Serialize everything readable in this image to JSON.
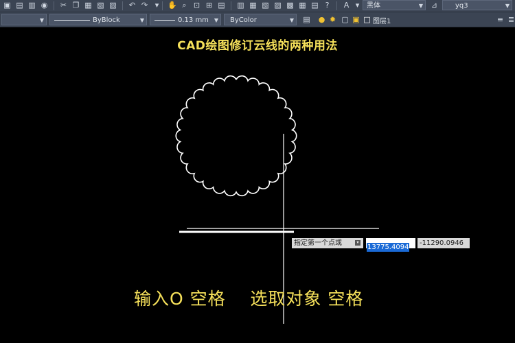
{
  "toolbar": {
    "font_name": "黑体",
    "style_name": "yq3",
    "linetype_label": "ByBlock",
    "lineweight_label": "0.13 mm",
    "color_label": "ByColor",
    "layer_label": "图层1",
    "icons": [
      "print-icon",
      "save-icon",
      "open-icon",
      "match-icon",
      "undo-icon",
      "redo-icon",
      "pan-icon",
      "zoom-icon",
      "help-icon",
      "text-icon",
      "bulb-icon",
      "sun-icon",
      "lock-icon"
    ]
  },
  "canvas": {
    "title": "CAD绘图修订云线的两种用法",
    "prompt_label": "指定第一个点或",
    "coord_x": "13775.4094",
    "coord_y": "-11290.0946",
    "caption": "输入O 空格    选取对象 空格"
  },
  "colors": {
    "caption": "#f5e05a",
    "background": "#000000",
    "toolbar": "#3b4453",
    "highlight": "#1a6ad6"
  }
}
